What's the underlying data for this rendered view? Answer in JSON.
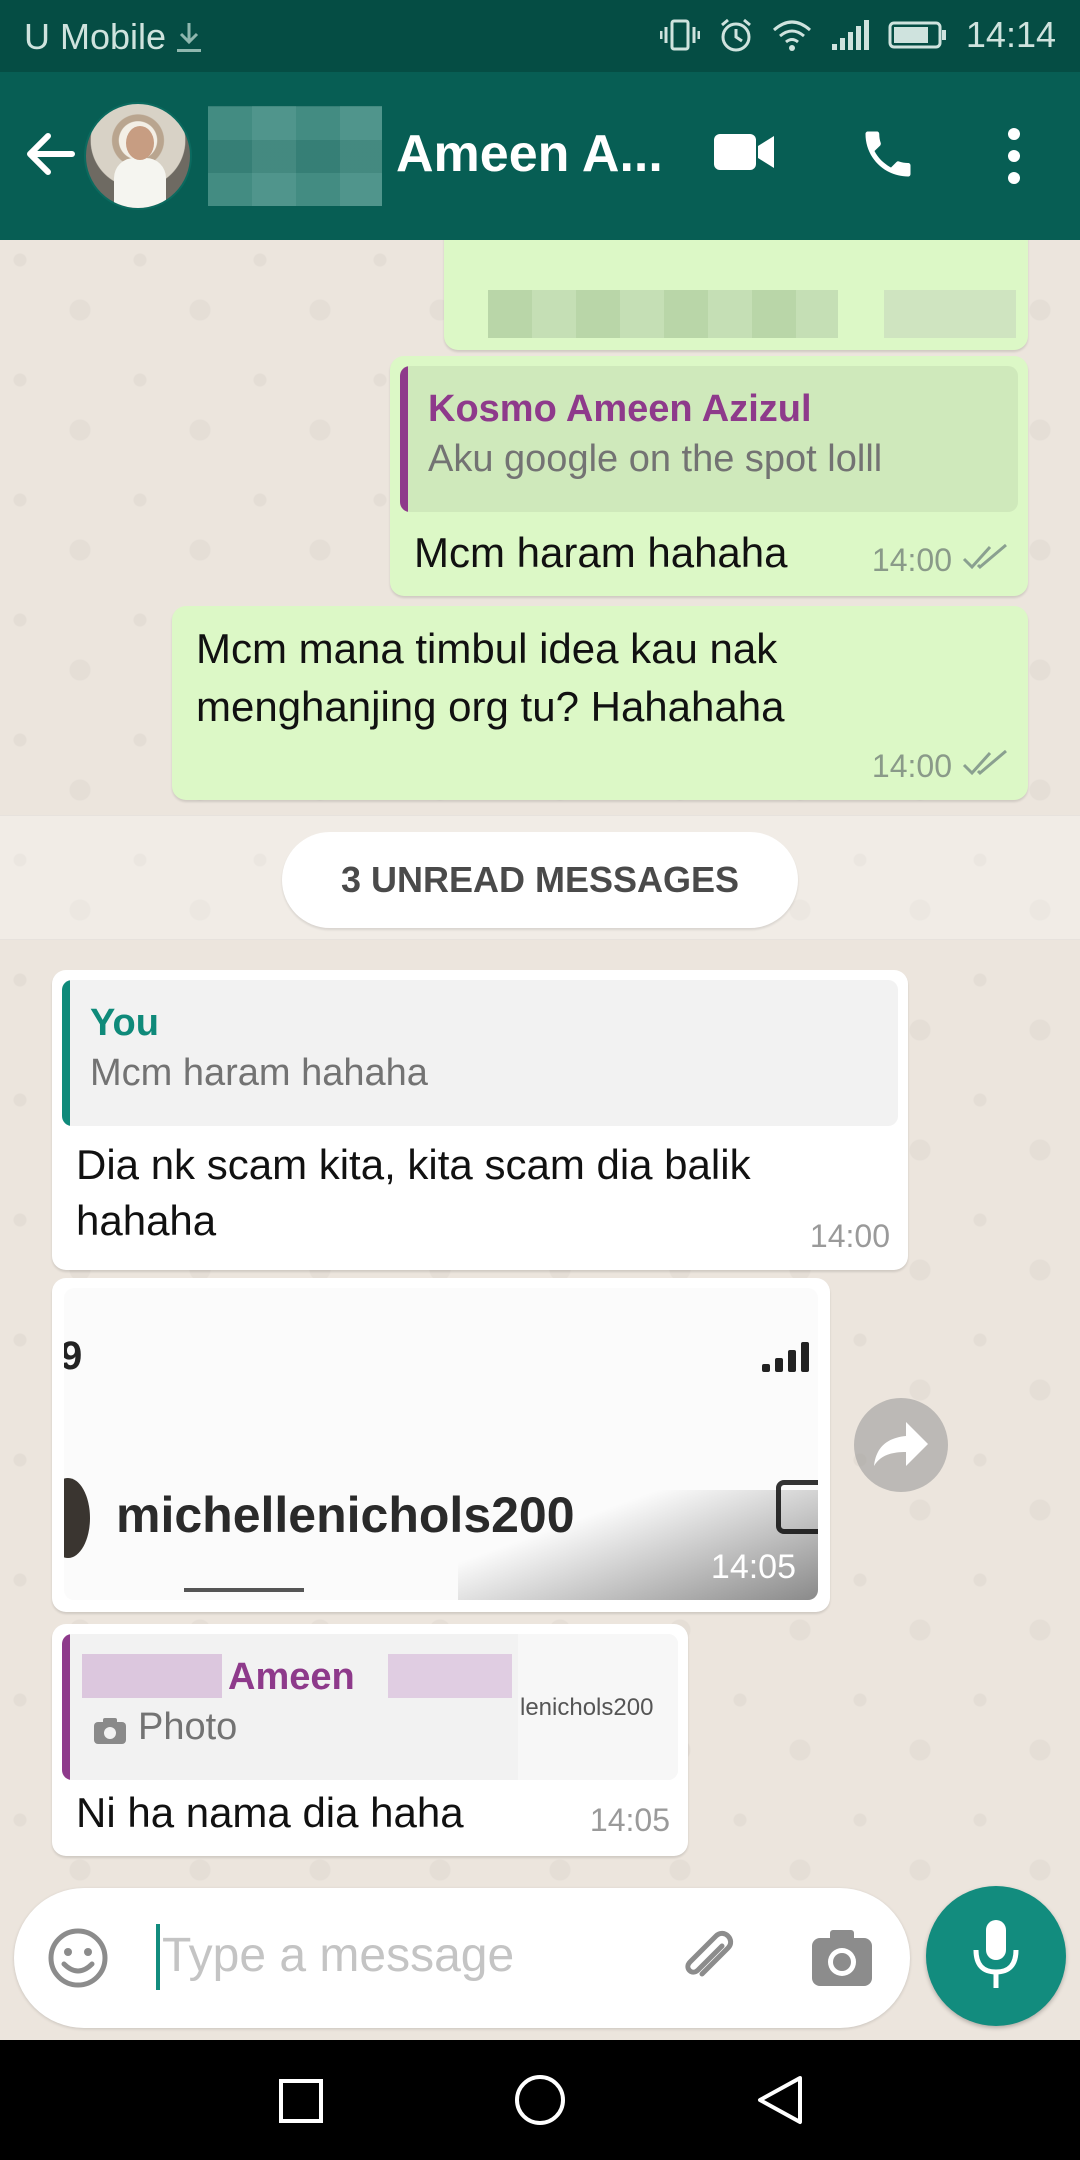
{
  "status_bar": {
    "carrier": "U Mobile",
    "time": "14:14"
  },
  "header": {
    "contact_name": "Ameen A..."
  },
  "messages": {
    "partial_top": {},
    "out1": {
      "quote_author": "Kosmo Ameen Azizul",
      "quote_text": "Aku google on the spot lolll",
      "text": "Mcm haram hahaha",
      "time": "14:00"
    },
    "out2": {
      "line1": "Mcm mana timbul idea kau nak",
      "line2": "menghanjing org tu? Hahahaha",
      "time": "14:00"
    },
    "unread": "3 UNREAD MESSAGES",
    "in1": {
      "quote_author": "You",
      "quote_text": "Mcm haram hahaha",
      "line1": "Dia nk scam kita, kita scam dia balik",
      "line2": "hahaha",
      "time": "14:00"
    },
    "in2": {
      "username": "michellenichols200",
      "time": "14:05"
    },
    "in3": {
      "quote_author": "Ameen",
      "quote_text": "Photo",
      "thumb_text": "lenichols200",
      "text": "Ni ha nama dia haha",
      "time": "14:05"
    }
  },
  "composer": {
    "placeholder": "Type a message"
  },
  "colors": {
    "header": "#075e54",
    "status_bar": "#054d44",
    "outgoing_bubble": "#dcf8c6",
    "incoming_bubble": "#ffffff",
    "accent": "#128c7e",
    "quote_purple": "#8e3a8b",
    "quote_teal": "#0f8a7a"
  },
  "icons": [
    "download-icon",
    "vibrate-icon",
    "alarm-icon",
    "wifi-icon",
    "signal-icon",
    "battery-icon",
    "back-arrow-icon",
    "video-call-icon",
    "phone-icon",
    "more-vert-icon",
    "double-check-icon",
    "forward-icon",
    "emoji-icon",
    "attach-icon",
    "camera-icon",
    "mic-icon",
    "recents-icon",
    "home-icon",
    "back-nav-icon",
    "photo-icon"
  ]
}
